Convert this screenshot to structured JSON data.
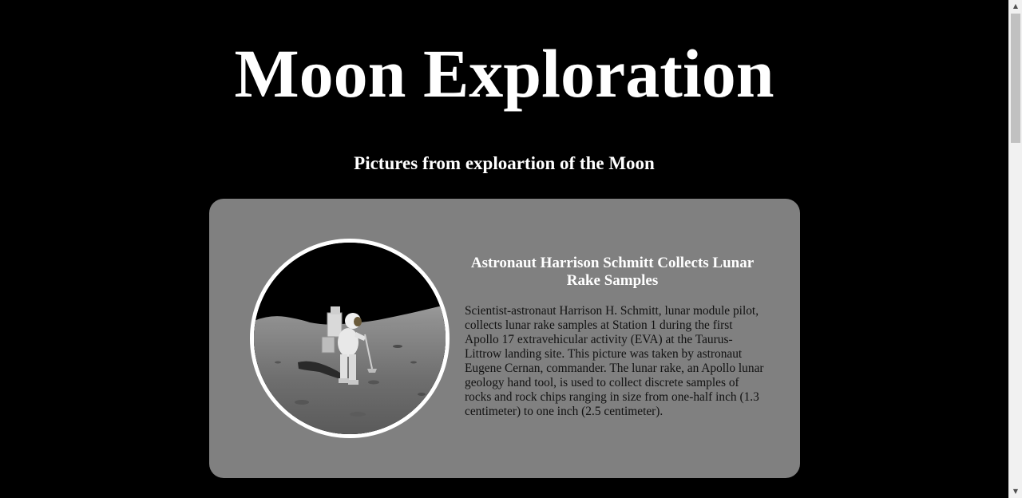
{
  "header": {
    "title": "Moon Exploration",
    "subtitle": "Pictures from exploartion of the Moon"
  },
  "card": {
    "image_alt": "Astronaut Harrison Schmitt collecting lunar rake samples",
    "title": "Astronaut Harrison Schmitt Collects Lunar Rake Samples",
    "description": "Scientist-astronaut Harrison H. Schmitt, lunar module pilot, collects lunar rake samples at Station 1 during the first Apollo 17 extravehicular activity (EVA) at the Taurus-Littrow landing site. This picture was taken by astronaut Eugene Cernan, commander. The lunar rake, an Apollo lunar geology hand tool, is used to collect discrete samples of rocks and rock chips ranging in size from one-half inch (1.3 centimeter) to one inch (2.5 centimeter)."
  },
  "scrollbar": {
    "up_icon": "arrow-up-icon",
    "down_icon": "arrow-down-icon"
  },
  "colors": {
    "background": "#000000",
    "card": "#808080",
    "title_text": "#ffffff",
    "body_text": "#111111"
  }
}
